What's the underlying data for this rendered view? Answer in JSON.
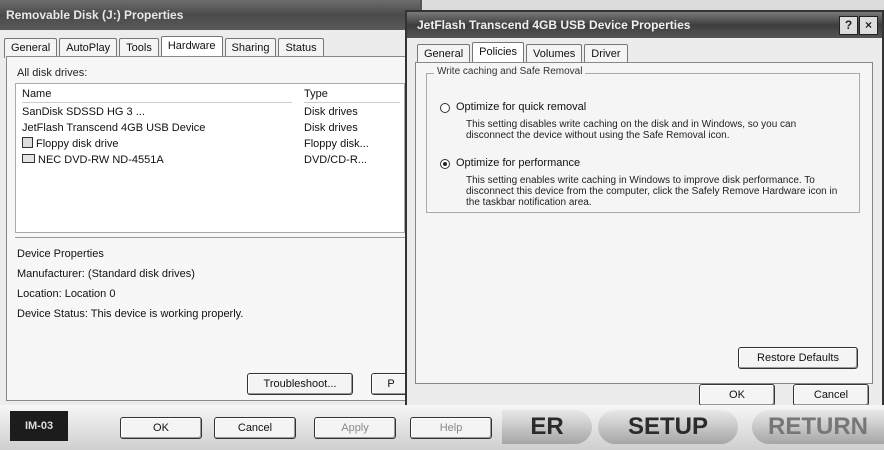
{
  "back_dialog": {
    "title": "Removable Disk (J:) Properties",
    "tabs": [
      "General",
      "AutoPlay",
      "Tools",
      "Hardware",
      "Sharing",
      "Status"
    ],
    "all_disk_drives_label": "All disk drives:",
    "columns": [
      "Name",
      "Type"
    ],
    "drives": [
      {
        "name": "SanDisk SDSSD HG 3 ...",
        "type": "Disk drives"
      },
      {
        "name": "JetFlash Transcend 4GB USB Device",
        "type": "Disk drives"
      },
      {
        "name": "Floppy disk drive",
        "type": "Floppy disk..."
      },
      {
        "name": "NEC DVD-RW ND-4551A",
        "type": "DVD/CD-R..."
      }
    ],
    "device_properties_label": "Device Properties",
    "manufacturer": "Manufacturer: (Standard disk drives)",
    "location": "Location: Location 0",
    "device_status": "Device Status: This device is working properly.",
    "troubleshoot_button": "Troubleshoot...",
    "properties_button_partial": "P"
  },
  "front_dialog": {
    "title": "JetFlash Transcend 4GB USB Device Properties",
    "tabs": [
      "General",
      "Policies",
      "Volumes",
      "Driver"
    ],
    "active_tab": "Policies",
    "group_label": "Write caching and Safe Removal",
    "option_quick": {
      "label": "Optimize for quick removal",
      "description": "This setting disables write caching on the disk and in Windows, so you can disconnect the device without using the Safe Removal icon."
    },
    "option_performance": {
      "label": "Optimize for performance",
      "description": "This setting enables write caching in Windows to improve disk performance. To disconnect this device from the computer, click the Safely Remove Hardware icon in the taskbar notification area."
    },
    "selected_option": "performance",
    "restore_defaults_button": "Restore Defaults",
    "ok_button": "OK",
    "cancel_button": "Cancel"
  },
  "bottom_bar": {
    "logo_text": "IM-03",
    "ok_button": "OK",
    "cancel_button": "Cancel",
    "apply_button": "Apply",
    "help_button": "Help",
    "nav_partial": "ER",
    "nav_setup": "SETUP",
    "nav_return": "RETURN"
  }
}
